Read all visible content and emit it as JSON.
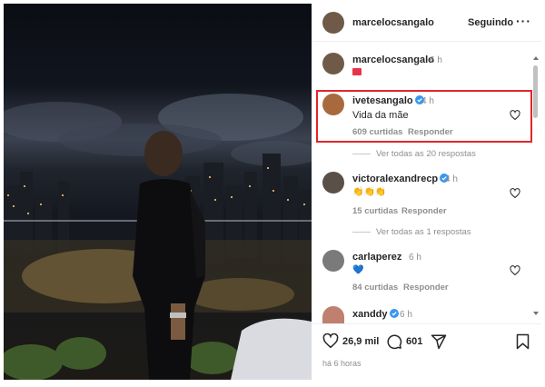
{
  "post": {
    "username": "marcelocsangalo",
    "follow_label": "Seguindo",
    "more_label": "···",
    "caption_username": "marcelocsangalo",
    "caption_time": "6 h"
  },
  "comments": [
    {
      "username": "ivetesangalo",
      "time": "4 h",
      "text": "Vida da mãe",
      "likes": "609 curtidas",
      "reply": "Responder",
      "view_replies": "Ver todas as 20 respostas"
    },
    {
      "username": "victoralexandrecp",
      "time": "4 h",
      "text": "👏👏👏",
      "likes": "15 curtidas",
      "reply": "Responder",
      "view_replies": "Ver todas as 1 respostas"
    },
    {
      "username": "carlaperez",
      "time": "6 h",
      "text": "💙",
      "likes": "84 curtidas",
      "reply": "Responder"
    },
    {
      "username": "xanddy",
      "time": "6 h",
      "text": ""
    }
  ],
  "actions": {
    "likes_count": "26,9 mil",
    "comments_count": "601",
    "posted_ago": "há 6 horas"
  },
  "icons": {
    "like": "heart-icon",
    "comment": "comment-icon",
    "share": "share-icon",
    "save": "bookmark-icon",
    "verified": "verified-badge-icon"
  },
  "colors": {
    "highlight": "#e0262b",
    "verified": "#3897f0",
    "text": "#262626",
    "muted": "#8e8e8e"
  }
}
